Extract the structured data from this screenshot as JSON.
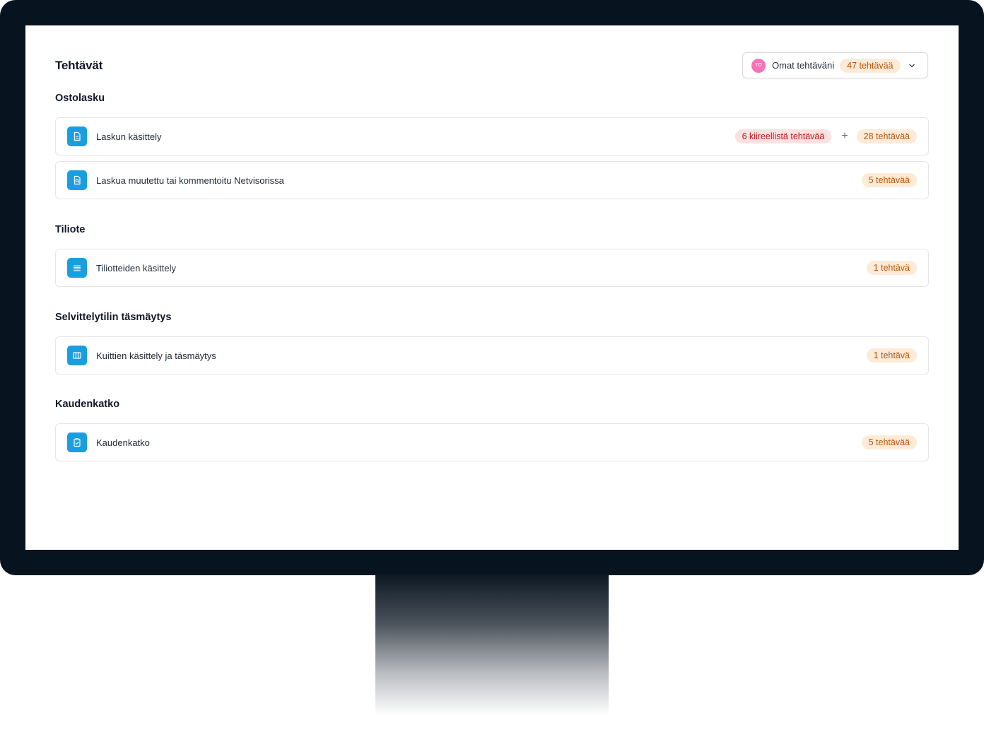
{
  "page": {
    "title": "Tehtävät"
  },
  "filter": {
    "avatar_initials": "TO",
    "label": "Omat tehtäväni",
    "count_badge": "47 tehtävää"
  },
  "sections": [
    {
      "title": "Ostolasku",
      "items": [
        {
          "label": "Laskun käsittely",
          "icon": "document-icon",
          "urgent_badge": "6 kiireellistä tehtävää",
          "count_badge": "28 tehtävää"
        },
        {
          "label": "Laskua muutettu tai kommentoitu Netvisorissa",
          "icon": "document-search-icon",
          "count_badge": "5 tehtävää"
        }
      ]
    },
    {
      "title": "Tiliote",
      "items": [
        {
          "label": "Tiliotteiden käsittely",
          "icon": "list-icon",
          "count_badge": "1 tehtävä"
        }
      ]
    },
    {
      "title": "Selvittelytilin täsmäytys",
      "items": [
        {
          "label": "Kuittien käsittely ja täsmäytys",
          "icon": "columns-icon",
          "count_badge": "1 tehtävä"
        }
      ]
    },
    {
      "title": "Kaudenkatko",
      "items": [
        {
          "label": "Kaudenkatko",
          "icon": "clipboard-check-icon",
          "count_badge": "5 tehtävää"
        }
      ]
    }
  ],
  "colors": {
    "accent": "#1a9ee0",
    "badge_orange_bg": "#fdebd7",
    "badge_orange_text": "#b45309",
    "badge_red_bg": "#fde0e0",
    "badge_red_text": "#b91c1c",
    "avatar": "#f472b6",
    "monitor_frame": "#07141f"
  }
}
